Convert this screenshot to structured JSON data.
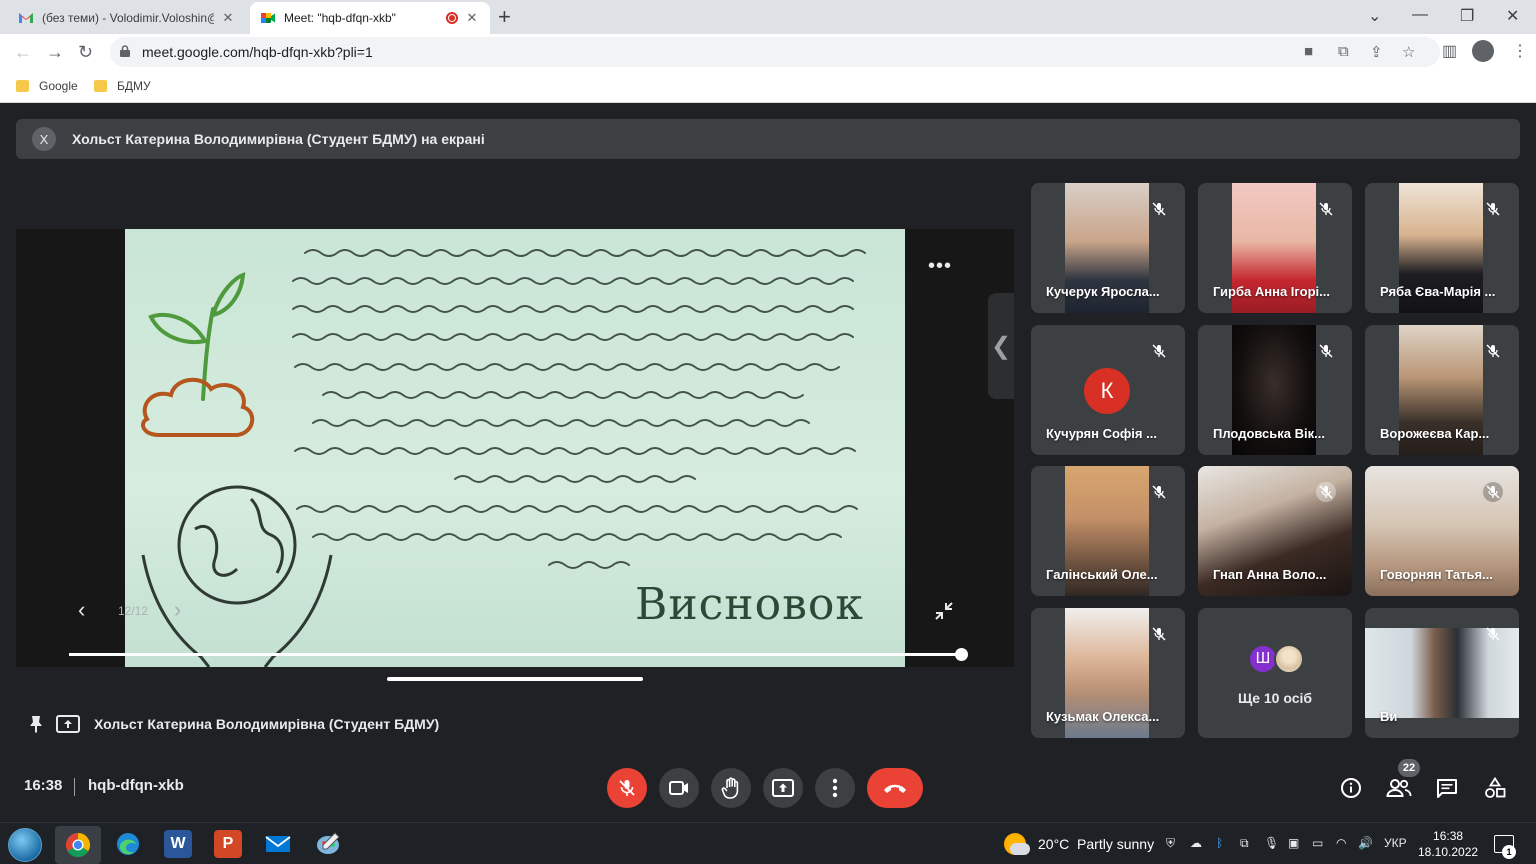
{
  "browser": {
    "tabs": [
      {
        "title": "(без теми) - Volodimir.Voloshin@",
        "active": false
      },
      {
        "title": "Meet: \"hqb-dfqn-xkb\"",
        "active": true
      }
    ],
    "url": "meet.google.com/hqb-dfqn-xkb?pli=1",
    "bookmarks": [
      "Google",
      "БДМУ"
    ]
  },
  "banner": {
    "close_label": "X",
    "text": "Хольст Катерина Володимирівна (Студент БДМУ) на екрані"
  },
  "presentation": {
    "slide_heading": "Висновок",
    "slide_counter": "12/12",
    "presenter": "Хольст Катерина Володимирівна (Студент БДМУ)"
  },
  "participants": [
    {
      "name": "Кучерук Яросла..."
    },
    {
      "name": "Гирба Анна Ігорі..."
    },
    {
      "name": "Ряба Єва-Марія ..."
    },
    {
      "name": "Кучурян Софія ...",
      "avatar_letter": "К"
    },
    {
      "name": "Плодовська Вік..."
    },
    {
      "name": "Ворожеєва Кар..."
    },
    {
      "name": "Галінський Оле..."
    },
    {
      "name": "Гнап Анна Воло..."
    },
    {
      "name": "Говорнян Татья..."
    },
    {
      "name": "Кузьмак Олекса..."
    },
    {
      "name": "Ви"
    }
  ],
  "more_people": {
    "avatar_letter": "Ш",
    "label": "Ще 10 осіб"
  },
  "meeting": {
    "time": "16:38",
    "code": "hqb-dfqn-xkb",
    "people_count": "22"
  },
  "taskbar": {
    "weather": "20°C  Partly sunny",
    "language": "УКР",
    "time": "16:38",
    "date": "18.10.2022",
    "notifications": "1"
  },
  "colors": {
    "meet_bg": "#202124",
    "tile_bg": "#3c4043",
    "hangup_red": "#ea4335",
    "avatar_k": "#d93025",
    "avatar_sh": "#8430ce"
  }
}
